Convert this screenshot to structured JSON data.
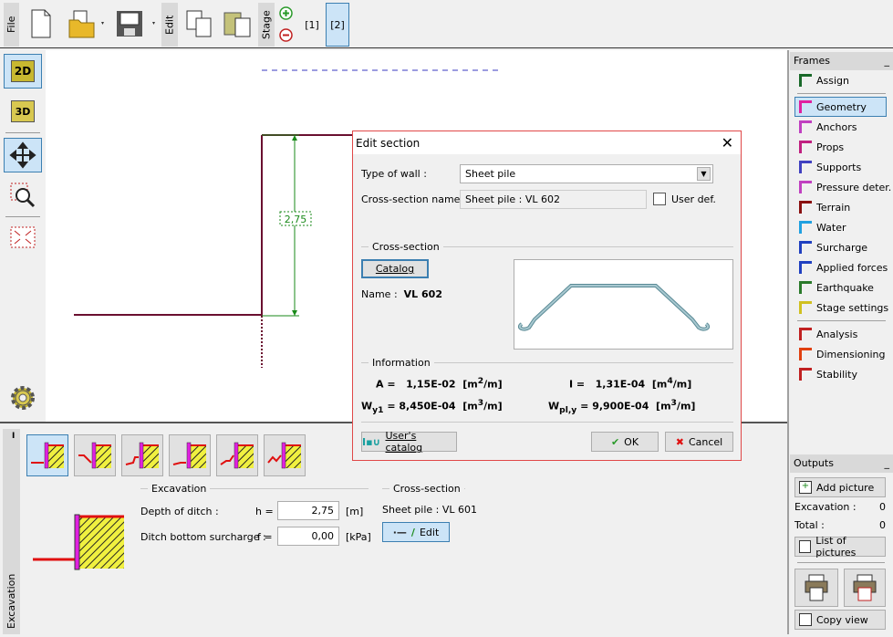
{
  "toolbar": {
    "file": "File",
    "edit": "Edit",
    "stage": "Stage",
    "stage_1": "[1]",
    "stage_2": "[2]",
    "icons": [
      "new-file-icon",
      "open-folder-icon",
      "save-disk-icon",
      "copy-icon",
      "paste-icon",
      "add-stage-icon",
      "remove-stage-icon"
    ]
  },
  "view_tools": {
    "2d": "2D",
    "3d": "3D"
  },
  "canvas": {
    "dimension_label": "2,75"
  },
  "dialog": {
    "title": "Edit section",
    "type_of_wall_label": "Type of wall :",
    "type_of_wall_value": "Sheet pile",
    "cross_section_name_label": "Cross-section name :",
    "cross_section_name_value": "Sheet pile : VL 602",
    "user_def_label": "User def.",
    "user_def_checked": false,
    "cross_section_group": "Cross-section",
    "catalog_button": "Catalog",
    "name_label": "Name :",
    "name_value": "VL 602",
    "information_group": "Information",
    "A_label": "A =",
    "A_value": "1,15E-02",
    "A_unit_pre": "[m",
    "A_unit_exp": "2",
    "A_unit_post": "/m]",
    "I_label": "I =",
    "I_value": "1,31E-04",
    "I_unit_pre": "[m",
    "I_unit_exp": "4",
    "I_unit_post": "/m]",
    "Wy1_label": "W",
    "Wy1_sub": "y1",
    "Wy1_eq": "=",
    "Wy1_value": "8,450E-04",
    "Wy1_unit_pre": "[m",
    "Wy1_unit_exp": "3",
    "Wy1_unit_post": "/m]",
    "Wply_label": "W",
    "Wply_sub": "pl,y",
    "Wply_eq": "=",
    "Wply_value": "9,900E-04",
    "Wply_unit_pre": "[m",
    "Wply_unit_exp": "3",
    "Wply_unit_post": "/m]",
    "users_catalog_button": "User's catalog",
    "ok_button": "OK",
    "cancel_button": "Cancel",
    "colors": {
      "border": "#e04848",
      "profile": "#8fb5bd"
    }
  },
  "frames": {
    "title": "Frames",
    "collapse": "_",
    "items": [
      {
        "label": "Assign"
      },
      {
        "label": "Geometry",
        "selected": true
      },
      {
        "label": "Anchors"
      },
      {
        "label": "Props"
      },
      {
        "label": "Supports"
      },
      {
        "label": "Pressure deter."
      },
      {
        "label": "Terrain"
      },
      {
        "label": "Water"
      },
      {
        "label": "Surcharge"
      },
      {
        "label": "Applied forces"
      },
      {
        "label": "Earthquake"
      },
      {
        "label": "Stage settings"
      },
      {
        "label": "Analysis"
      },
      {
        "label": "Dimensioning"
      },
      {
        "label": "Stability"
      }
    ]
  },
  "outputs": {
    "title": "Outputs",
    "collapse": "_",
    "add_picture": "Add picture",
    "excavation_label": "Excavation :",
    "excavation_count": "0",
    "total_label": "Total :",
    "total_count": "0",
    "list_of_pictures": "List of pictures",
    "copy_view": "Copy view"
  },
  "bottom": {
    "panel_label": "Excavation",
    "pin": "I",
    "excavation_group": "Excavation",
    "depth_label": "Depth of ditch :",
    "depth_symbol": "h =",
    "depth_value": "2,75",
    "depth_unit": "[m]",
    "surcharge_label": "Ditch bottom surcharge :",
    "surcharge_symbol": "f =",
    "surcharge_value": "0,00",
    "surcharge_unit": "[kPa]",
    "cross_section_group": "Cross-section",
    "cross_section_value": "Sheet pile : VL 601",
    "edit_button": "Edit"
  }
}
